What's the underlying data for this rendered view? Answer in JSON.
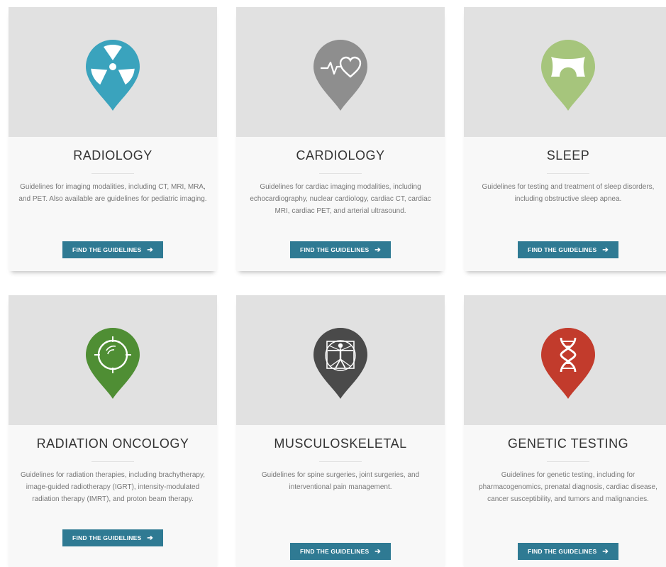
{
  "cards": [
    {
      "title": "RADIOLOGY",
      "description": "Guidelines for imaging modalities, including CT, MRI, MRA, and PET. Also available are guidelines for pediatric imaging.",
      "button_label": "FIND THE GUIDELINES",
      "icon": "radiation-icon",
      "color": "#3aa3bd"
    },
    {
      "title": "CARDIOLOGY",
      "description": "Guidelines for cardiac imaging modalities, including echocardiography, nuclear cardiology, cardiac CT, cardiac MRI, cardiac PET, and arterial ultrasound.",
      "button_label": "FIND THE GUIDELINES",
      "icon": "heartbeat-icon",
      "color": "#8e8e8e"
    },
    {
      "title": "SLEEP",
      "description": "Guidelines for testing and treatment of sleep disorders, including obstructive sleep apnea.",
      "button_label": "FIND THE GUIDELINES",
      "icon": "pillow-icon",
      "color": "#a6c57c"
    },
    {
      "title": "RADIATION ONCOLOGY",
      "description": "Guidelines for radiation therapies, including brachytherapy, image-guided radiotherapy (IGRT), intensity-modulated radiation therapy (IMRT), and proton beam therapy.",
      "button_label": "FIND THE GUIDELINES",
      "icon": "target-icon",
      "color": "#4f8e34"
    },
    {
      "title": "MUSCULOSKELETAL",
      "description": "Guidelines for spine surgeries, joint surgeries, and interventional pain management.",
      "button_label": "FIND THE GUIDELINES",
      "icon": "vitruvian-man-icon",
      "color": "#4a4a4a"
    },
    {
      "title": "GENETIC TESTING",
      "description": "Guidelines for genetic testing, including for pharmacogenomics, prenatal diagnosis, cardiac disease, cancer susceptibility, and tumors and malignancies.",
      "button_label": "FIND THE GUIDELINES",
      "icon": "dna-icon",
      "color": "#c23b2c"
    }
  ],
  "theme": {
    "button_color": "#2f7a93",
    "image_bg": "#e1e1e1",
    "card_bg": "#f8f8f8"
  }
}
